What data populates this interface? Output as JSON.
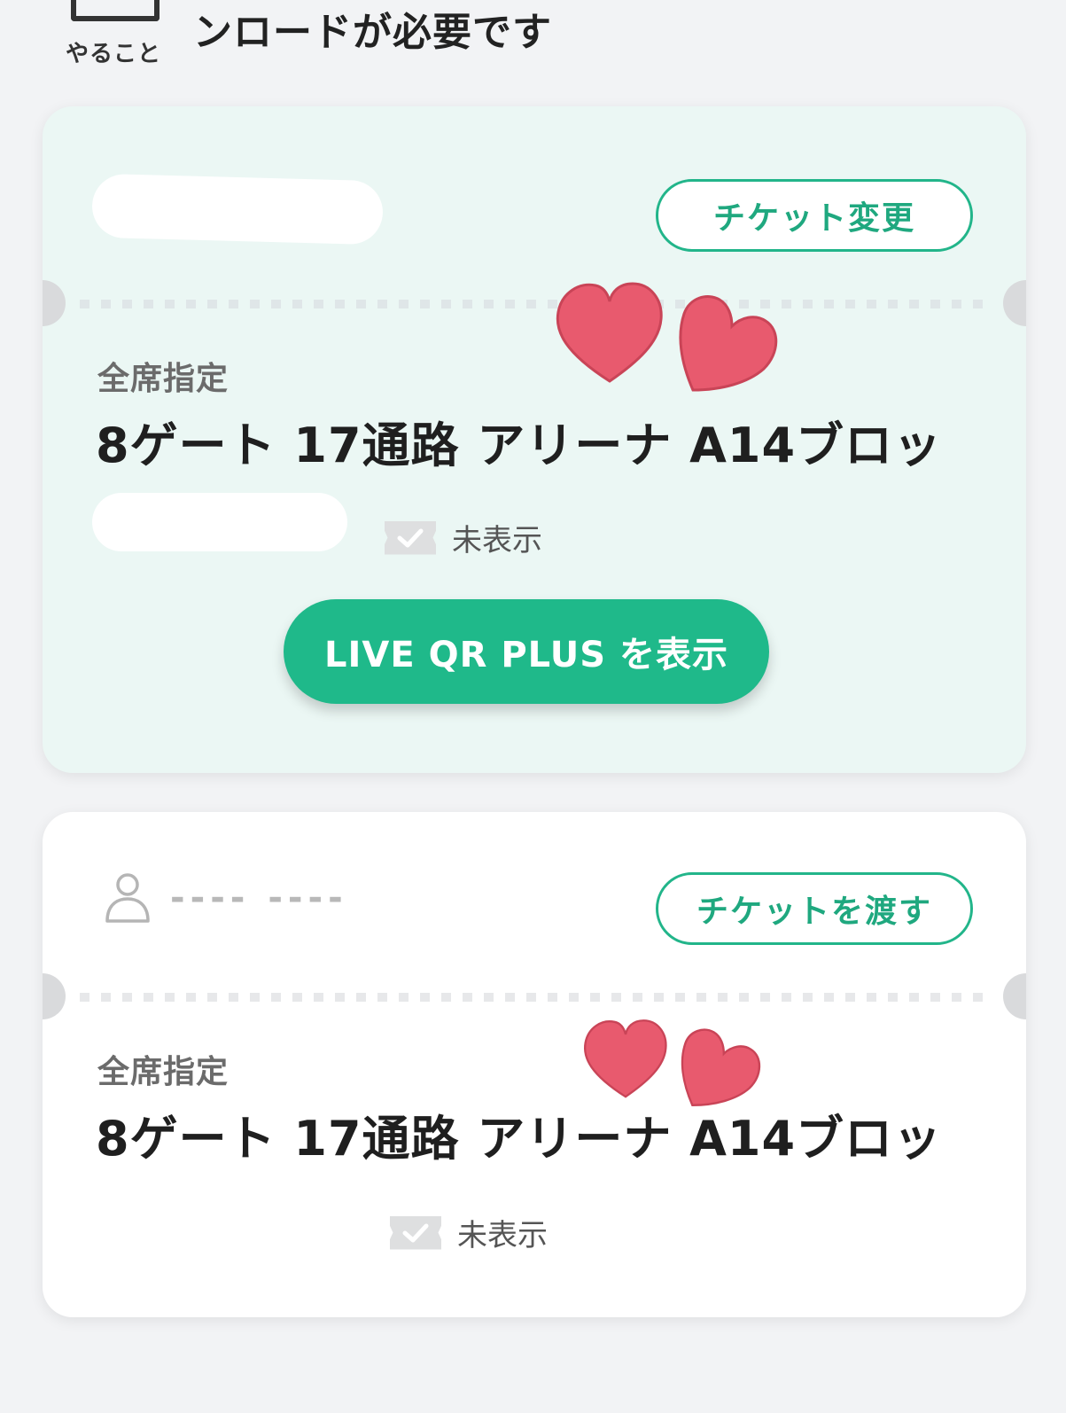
{
  "header": {
    "todo_label": "やること",
    "todo_text": "ンロードが必要です"
  },
  "tickets": [
    {
      "action_label": "チケット変更",
      "seat_type": "全席指定",
      "seat_name": "8ゲート 17通路 アリーナ A14ブロッ",
      "hidden_label": "未表示",
      "qr_button_label": "LIVE QR PLUS を表示"
    },
    {
      "owner_name": "---- ----",
      "action_label": "チケットを渡す",
      "seat_type": "全席指定",
      "seat_name": "8ゲート 17通路 アリーナ A14ブロッ",
      "hidden_label": "未表示"
    }
  ],
  "colors": {
    "accent": "#1fb98a",
    "card_active_bg": "#ebf7f4",
    "heart": "#e85a6e"
  },
  "icons": {
    "user": "user-icon",
    "check": "check-icon",
    "heart": "heart-sticker"
  }
}
